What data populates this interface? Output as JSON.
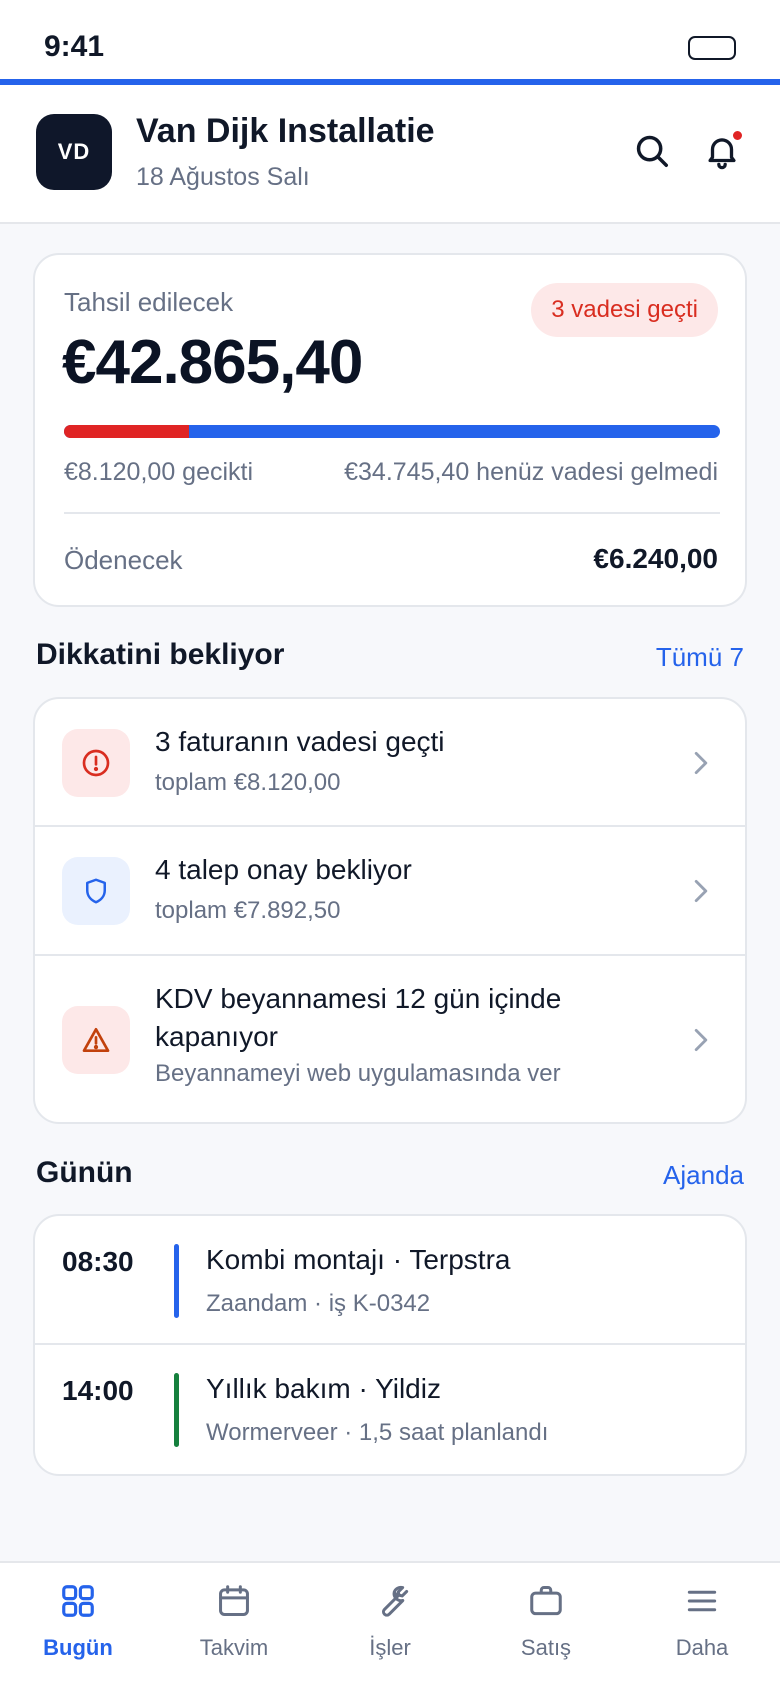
{
  "status_bar": {
    "time": "9:41"
  },
  "header": {
    "avatar_initials": "VD",
    "company_name": "Van Dijk Installatie",
    "date": "18 Ağustos Salı"
  },
  "balance": {
    "label": "Tahsil edilecek",
    "amount": "€42.865,40",
    "overdue_badge": "3 vadesi geçti",
    "overdue_fraction": 0.19,
    "overdue_text": "€8.120,00 gecikti",
    "not_due_text": "€34.745,40 henüz vadesi gelmedi",
    "payable_label": "Ödenecek",
    "payable_amount": "€6.240,00"
  },
  "attention": {
    "title": "Dikkatini bekliyor",
    "link": "Tümü 7",
    "items": [
      {
        "icon": "alert-circle-icon",
        "title": "3 faturanın vadesi geçti",
        "subtitle": "toplam €8.120,00"
      },
      {
        "icon": "shield-icon",
        "title": "4 talep onay bekliyor",
        "subtitle": "toplam €7.892,50"
      },
      {
        "icon": "warning-triangle-icon",
        "title": "KDV beyannamesi 12 gün içinde kapanıyor",
        "subtitle": "Beyannameyi web uygulamasında ver"
      }
    ]
  },
  "today": {
    "title": "Günün",
    "link": "Ajanda",
    "items": [
      {
        "time": "08:30",
        "title": "Kombi montajı · Terpstra",
        "subtitle": "Zaandam · iş K-0342",
        "color": "#2563eb"
      },
      {
        "time": "14:00",
        "title": "Yıllık bakım · Yildiz",
        "subtitle": "Wormerveer · 1,5 saat planlandı",
        "color": "#15803d"
      }
    ]
  },
  "nav": {
    "items": [
      {
        "icon": "grid-icon",
        "label": "Bugün",
        "active": true
      },
      {
        "icon": "calendar-icon",
        "label": "Takvim"
      },
      {
        "icon": "wrench-icon",
        "label": "İşler"
      },
      {
        "icon": "briefcase-icon",
        "label": "Satış"
      },
      {
        "icon": "menu-icon",
        "label": "Daha"
      }
    ]
  },
  "colors": {
    "accent": "#2563eb",
    "danger": "#e02424",
    "warning": "#c2410c"
  }
}
